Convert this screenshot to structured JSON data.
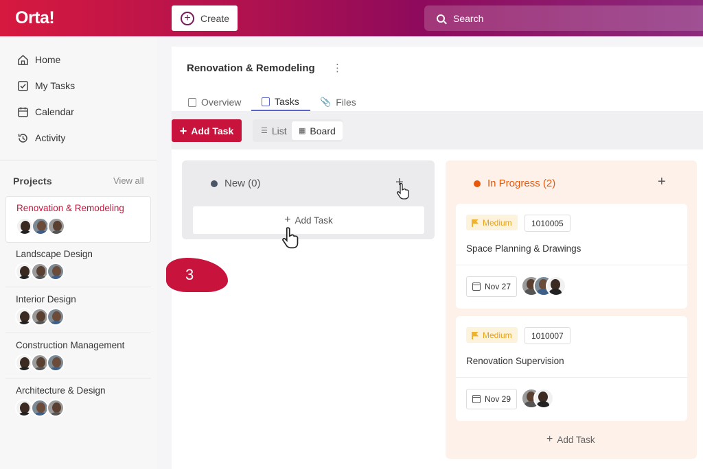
{
  "header": {
    "logo": "Orta!",
    "create_label": "Create",
    "search_placeholder": "Search"
  },
  "sidebar": {
    "nav": [
      {
        "label": "Home",
        "icon": "home-icon"
      },
      {
        "label": "My Tasks",
        "icon": "checkbox-icon"
      },
      {
        "label": "Calendar",
        "icon": "calendar-icon"
      },
      {
        "label": "Activity",
        "icon": "history-icon"
      }
    ],
    "projects_title": "Projects",
    "view_all": "View all",
    "projects": [
      {
        "name": "Renovation & Remodeling",
        "active": true
      },
      {
        "name": "Landscape Design",
        "active": false
      },
      {
        "name": "Interior Design",
        "active": false
      },
      {
        "name": "Construction Management",
        "active": false
      },
      {
        "name": "Architecture & Design",
        "active": false
      }
    ]
  },
  "main": {
    "project_title": "Renovation & Remodeling",
    "tabs": [
      {
        "label": "Overview",
        "active": false
      },
      {
        "label": "Tasks",
        "active": true
      },
      {
        "label": "Files",
        "active": false
      }
    ],
    "add_task_label": "Add Task",
    "view_toggle": {
      "list": "List",
      "board": "Board",
      "selected": "Board"
    }
  },
  "board": {
    "columns": [
      {
        "title": "New (0)",
        "dot_color": "#4a5568",
        "add_label": "Add Task"
      },
      {
        "title": "In Progress (2)",
        "dot_color": "#e8590c",
        "add_label": "Add Task"
      }
    ],
    "cards": [
      {
        "priority": "Medium",
        "id": "1010005",
        "title": "Space Planning & Drawings",
        "due": "Nov 27"
      },
      {
        "priority": "Medium",
        "id": "1010007",
        "title": "Renovation Supervision",
        "due": "Nov 29"
      }
    ]
  },
  "callout": {
    "step": "3"
  },
  "colors": {
    "brand": "#c8143c",
    "accent_tab": "#5b62c8",
    "priority": "#e6a21a"
  }
}
